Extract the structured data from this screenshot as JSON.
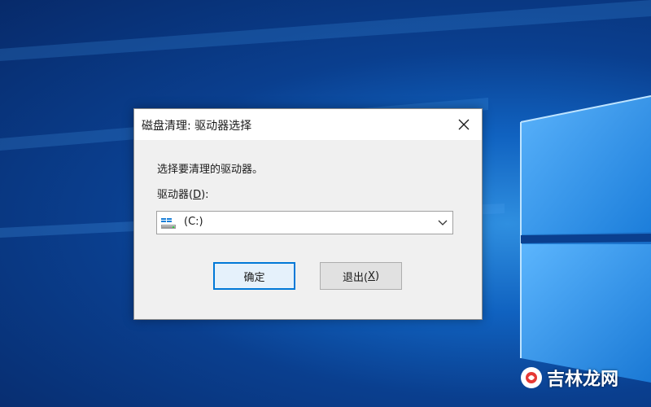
{
  "dialog": {
    "title": "磁盘清理: 驱动器选择",
    "prompt": "选择要清理的驱动器。",
    "drive_label_prefix": "驱动器(",
    "drive_label_mnemonic": "D",
    "drive_label_suffix": "):",
    "selected_drive": "(C:)",
    "ok_label": "确定",
    "cancel_prefix": "退出(",
    "cancel_mnemonic": "X",
    "cancel_suffix": ")"
  },
  "watermark": {
    "text": "吉林龙网"
  },
  "colors": {
    "accent": "#0078d7",
    "dialog_bg": "#f0f0f0",
    "titlebar_bg": "#ffffff",
    "desktop_blue": "#1062c0"
  },
  "icons": {
    "close": "close-icon",
    "drive": "hard-drive-icon",
    "dropdown": "chevron-down-icon"
  }
}
